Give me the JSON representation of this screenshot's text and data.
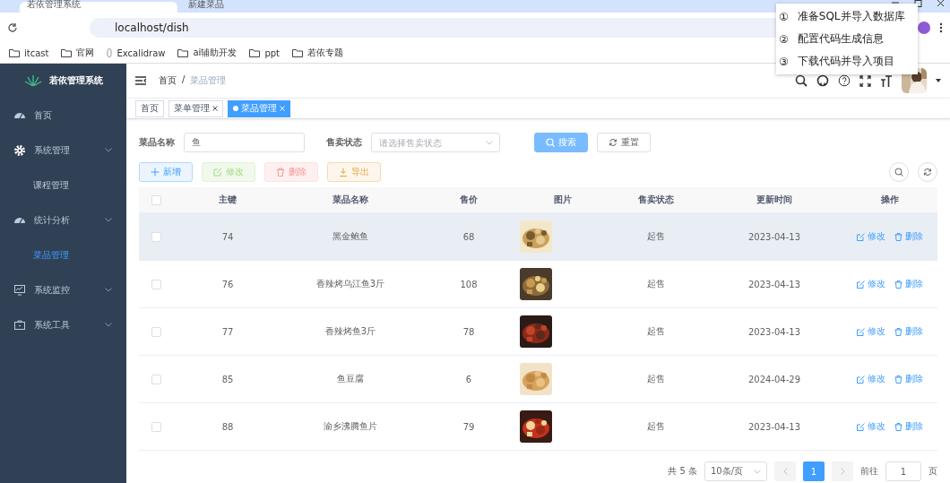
{
  "browser": {
    "tabs": [
      {
        "title": "若依管理系统",
        "selected": true
      },
      {
        "title": "新建菜品",
        "selected": false
      }
    ],
    "address": "localhost/dish",
    "bookmarks": [
      {
        "label": "itcast",
        "kind": "folder"
      },
      {
        "label": "官网",
        "kind": "folder"
      },
      {
        "label": "Excalidraw",
        "kind": "link"
      },
      {
        "label": "ai辅助开发",
        "kind": "folder"
      },
      {
        "label": "ppt",
        "kind": "folder"
      },
      {
        "label": "若依专题",
        "kind": "folder"
      }
    ]
  },
  "steps_popup": [
    "①",
    "准备SQL并导入数据库",
    "②",
    "配置代码生成信息",
    "③",
    "下载代码并导入项目"
  ],
  "sidebar": {
    "brand": "若依管理系统",
    "items": [
      {
        "label": "首页",
        "selected": false
      },
      {
        "label": "系统管理",
        "selected": false,
        "children": [
          {
            "label": "课程管理",
            "selected": false
          }
        ]
      },
      {
        "label": "统计分析",
        "selected": false,
        "children": [
          {
            "label": "菜品管理",
            "selected": true
          }
        ]
      },
      {
        "label": "系统监控",
        "selected": false,
        "collapsed": true
      },
      {
        "label": "系统工具",
        "selected": false,
        "collapsed": true
      }
    ]
  },
  "breadcrumb": {
    "items": [
      "首页",
      "菜品管理"
    ],
    "separator": "/"
  },
  "tags": [
    {
      "label": "首页",
      "closable": false,
      "selected": false
    },
    {
      "label": "菜单管理",
      "closable": true,
      "selected": false
    },
    {
      "label": "菜品管理",
      "closable": true,
      "selected": true
    }
  ],
  "search": {
    "fields": [
      {
        "label": "菜品名称",
        "kind": "input",
        "value": "鱼"
      },
      {
        "label": "售卖状态",
        "kind": "select",
        "placeholder": "请选择售卖状态"
      }
    ],
    "search_button": "搜索",
    "reset_button": "重置"
  },
  "toolbar": [
    {
      "label": "新增",
      "kind": "add",
      "disabled": false
    },
    {
      "label": "修改",
      "kind": "edit",
      "disabled": true
    },
    {
      "label": "删除",
      "kind": "delete",
      "disabled": true
    },
    {
      "label": "导出",
      "kind": "export",
      "disabled": false
    }
  ],
  "table": {
    "select_all_checked": false,
    "columns": [
      "主键",
      "菜品名称",
      "售价",
      "图片",
      "售卖状态",
      "更新时间",
      "操作"
    ],
    "rows": [
      {
        "id": "74",
        "name": "黑金鲍鱼",
        "price": "68",
        "image": {
          "kind": "picture"
        },
        "status": "起售",
        "updated": "2023-04-13",
        "actions": [
          "修改",
          "删除"
        ],
        "hover": true,
        "checked": false
      },
      {
        "id": "76",
        "name": "香辣烤乌江鱼3斤",
        "price": "108",
        "image": {
          "kind": "picture"
        },
        "status": "起售",
        "updated": "2023-04-13",
        "actions": [
          "修改",
          "删除"
        ],
        "hover": false,
        "checked": false
      },
      {
        "id": "77",
        "name": "香辣烤鱼3斤",
        "price": "78",
        "image": {
          "kind": "picture"
        },
        "status": "起售",
        "updated": "2023-04-13",
        "actions": [
          "修改",
          "删除"
        ],
        "hover": false,
        "checked": false
      },
      {
        "id": "85",
        "name": "鱼豆腐",
        "price": "6",
        "image": {
          "kind": "picture"
        },
        "status": "起售",
        "updated": "2024-04-29",
        "actions": [
          "修改",
          "删除"
        ],
        "hover": false,
        "checked": false
      },
      {
        "id": "88",
        "name": "渝乡沸腾鱼片",
        "price": "79",
        "image": {
          "kind": "picture"
        },
        "status": "起售",
        "updated": "2023-04-13",
        "actions": [
          "修改",
          "删除"
        ],
        "hover": false,
        "checked": false
      }
    ]
  },
  "pagination": {
    "total": "共 5 条",
    "page_size": "10条/页",
    "pages": [
      {
        "label": "1",
        "selected": true
      }
    ],
    "goto_label": "前往",
    "goto_value": "1",
    "goto_suffix": "页"
  }
}
